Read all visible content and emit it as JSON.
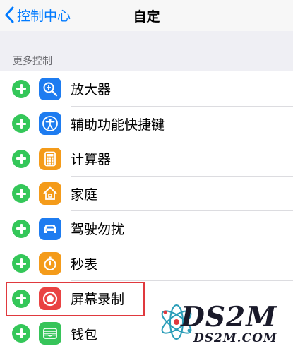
{
  "navbar": {
    "back_label": "控制中心",
    "title": "自定"
  },
  "section": {
    "header": "更多控制"
  },
  "items": [
    {
      "label": "放大器",
      "icon": "magnifier-icon",
      "color": "#1e7cf0"
    },
    {
      "label": "辅助功能快捷键",
      "icon": "accessibility-icon",
      "color": "#1e7cf0"
    },
    {
      "label": "计算器",
      "icon": "calculator-icon",
      "color": "#f49b1a"
    },
    {
      "label": "家庭",
      "icon": "home-icon",
      "color": "#f49b1a"
    },
    {
      "label": "驾驶勿扰",
      "icon": "car-icon",
      "color": "#1e7cf0"
    },
    {
      "label": "秒表",
      "icon": "stopwatch-icon",
      "color": "#f49b1a"
    },
    {
      "label": "屏幕录制",
      "icon": "record-icon",
      "color": "#e94343"
    },
    {
      "label": "钱包",
      "icon": "wallet-icon",
      "color": "#37c45a"
    }
  ],
  "watermark": {
    "logo": "DS2M",
    "url": "DS2M.COM"
  },
  "colors": {
    "accent": "#007aff",
    "add_green": "#34c759",
    "highlight_red": "#e0393e"
  }
}
